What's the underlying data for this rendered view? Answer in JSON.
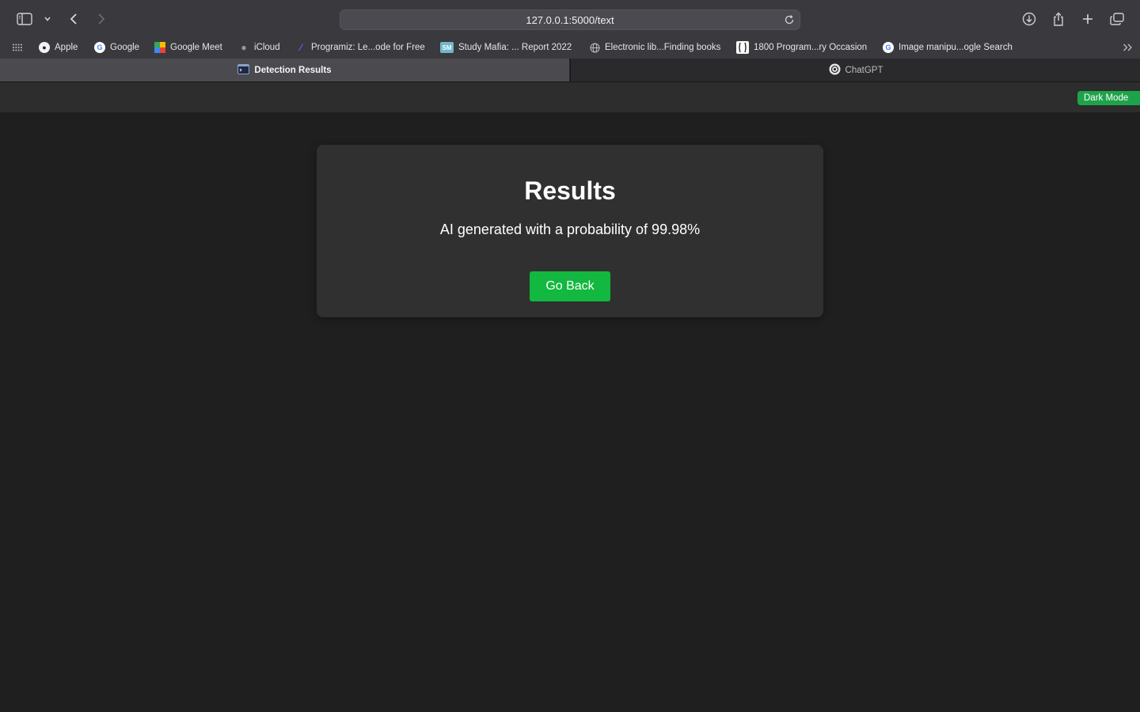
{
  "browser": {
    "url": "127.0.0.1:5000/text",
    "bookmarks": [
      {
        "label": "Apple",
        "icon": "apple-icon"
      },
      {
        "label": "Google",
        "icon": "google-icon"
      },
      {
        "label": "Google Meet",
        "icon": "google-meet-icon"
      },
      {
        "label": "iCloud",
        "icon": "apple-icon"
      },
      {
        "label": "Programiz: Le...ode for Free",
        "icon": "programiz-icon"
      },
      {
        "label": "Study Mafia: ... Report 2022",
        "icon": "study-mafia-icon"
      },
      {
        "label": "Electronic lib...Finding books",
        "icon": "globe-icon"
      },
      {
        "label": "1800 Program...ry Occasion",
        "icon": "page-icon"
      },
      {
        "label": "Image manipu...ogle Search",
        "icon": "google-icon"
      }
    ],
    "tabs": [
      {
        "label": "Detection Results",
        "active": true,
        "icon": "terminal-icon"
      },
      {
        "label": "ChatGPT",
        "active": false,
        "icon": "chatgpt-icon"
      }
    ]
  },
  "page": {
    "dark_mode_label": "Dark Mode",
    "title": "Results",
    "result_text": "AI generated with a probability of 99.98%",
    "go_back_label": "Go Back"
  },
  "colors": {
    "background": "#1f1f1f",
    "card": "#303030",
    "accent_green": "#12b83f"
  }
}
